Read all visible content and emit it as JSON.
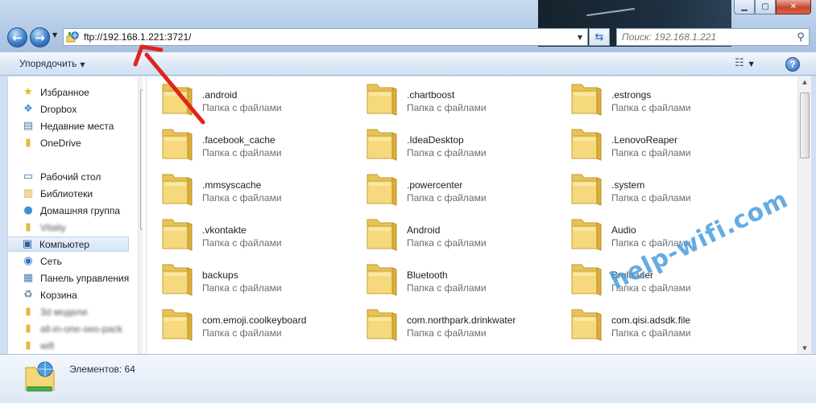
{
  "navigation": {
    "back_icon": "back-arrow-icon",
    "forward_icon": "forward-arrow-icon",
    "address": "ftp://192.168.1.221:3721/",
    "search_placeholder": "Поиск: 192.168.1.221"
  },
  "toolbar": {
    "organize_label": "Упорядочить",
    "help_label": "?"
  },
  "sidebar": {
    "items": [
      {
        "label": "Избранное",
        "icon": "star-icon"
      },
      {
        "label": "Dropbox",
        "icon": "dropbox-icon"
      },
      {
        "label": "Недавние места",
        "icon": "recent-places-icon"
      },
      {
        "label": "OneDrive",
        "icon": "folder-icon"
      },
      {
        "label": "Рабочий стол",
        "icon": "desktop-icon"
      },
      {
        "label": "Библиотеки",
        "icon": "libraries-icon"
      },
      {
        "label": "Домашняя группа",
        "icon": "homegroup-icon"
      },
      {
        "label": "Компьютер",
        "icon": "computer-icon",
        "selected": true
      },
      {
        "label": "Сеть",
        "icon": "network-icon"
      },
      {
        "label": "Панель управления",
        "icon": "control-panel-icon"
      },
      {
        "label": "Корзина",
        "icon": "recycle-bin-icon"
      }
    ],
    "blurred_items": [
      {
        "label": "Vitaliy",
        "icon": "user-folder-icon"
      },
      {
        "label": "3d модели",
        "icon": "folder-icon"
      },
      {
        "label": "all-in-one-seo-pack",
        "icon": "folder-icon"
      },
      {
        "label": "wifi",
        "icon": "folder-icon"
      }
    ]
  },
  "folders": [
    {
      "name": ".android",
      "type": "Папка с файлами"
    },
    {
      "name": ".chartboost",
      "type": "Папка с файлами"
    },
    {
      "name": ".estrongs",
      "type": "Папка с файлами"
    },
    {
      "name": ".facebook_cache",
      "type": "Папка с файлами"
    },
    {
      "name": ".IdeaDesktop",
      "type": "Папка с файлами"
    },
    {
      "name": ".LenovoReaper",
      "type": "Папка с файлами"
    },
    {
      "name": ".mmsyscache",
      "type": "Папка с файлами"
    },
    {
      "name": ".powercenter",
      "type": "Папка с файлами"
    },
    {
      "name": ".system",
      "type": "Папка с файлами"
    },
    {
      "name": ".vkontakte",
      "type": "Папка с файлами"
    },
    {
      "name": "Android",
      "type": "Папка с файлами"
    },
    {
      "name": "Audio",
      "type": "Папка с файлами"
    },
    {
      "name": "backups",
      "type": "Папка с файлами"
    },
    {
      "name": "Bluetooth",
      "type": "Папка с файлами"
    },
    {
      "name": "Broloader",
      "type": "Папка с файлами"
    },
    {
      "name": "com.emoji.coolkeyboard",
      "type": "Папка с файлами"
    },
    {
      "name": "com.northpark.drinkwater",
      "type": "Папка с файлами"
    },
    {
      "name": "com.qisi.adsdk.file",
      "type": "Папка с файлами"
    }
  ],
  "status": {
    "items_count": "Элементов: 64"
  },
  "watermark": "help-wifi.com",
  "colors": {
    "annotation_arrow": "#e0241c",
    "folder_yellow": "#f1d36b",
    "watermark": "#4a9ee0"
  }
}
